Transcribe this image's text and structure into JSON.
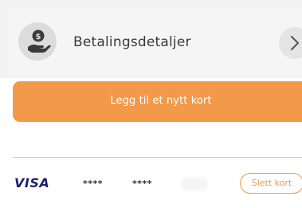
{
  "header": {
    "title": "Betalingsdetaljer",
    "icon": "hand-coin-icon",
    "chevron_icon": "chevron-right-icon"
  },
  "actions": {
    "add_card_label": "Legg til et nytt kort"
  },
  "card": {
    "brand": "VISA",
    "mask_1": "****",
    "mask_2": "****",
    "mask_3": "****",
    "delete_label": "Slett kort"
  },
  "colors": {
    "accent": "#f2994a",
    "visa_blue": "#1a1f71",
    "header_bg": "#f5f5f5",
    "icon_bg": "#dcdcdc"
  }
}
